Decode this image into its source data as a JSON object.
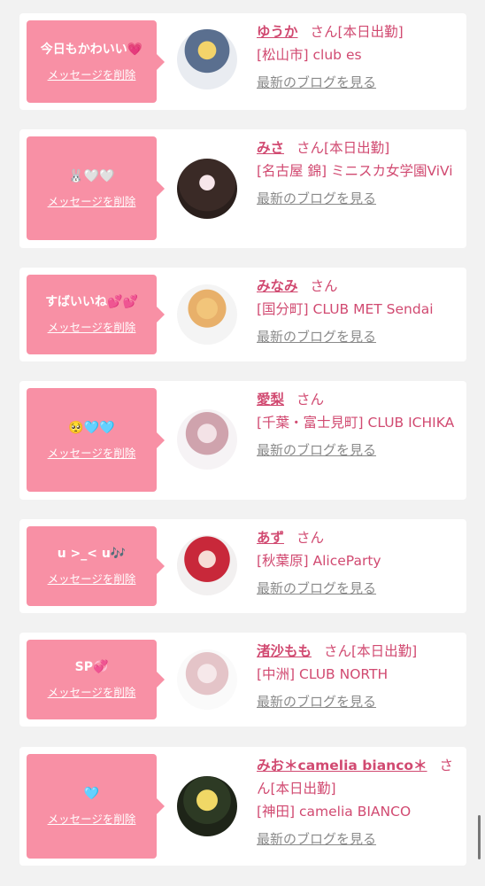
{
  "colors": {
    "bubble": "#f890a5",
    "accent": "#d14a71",
    "muted": "#8a8a8a"
  },
  "delete_label": "メッセージを削除",
  "blog_label": "最新のブログを見る",
  "cards": [
    {
      "message": "今日もかわいい💗",
      "name": "ゆうか",
      "suffix": "さん[本日出勤]",
      "shop": "[松山市] club es"
    },
    {
      "message": "🐰🤍🤍",
      "name": "みさ",
      "suffix": "さん[本日出勤]",
      "shop": "[名古屋 錦] ミニスカ女学園ViVi"
    },
    {
      "message": "すばいいね💕💕",
      "name": "みなみ",
      "suffix": "さん",
      "shop": "[国分町] CLUB MET Sendai"
    },
    {
      "message": "🥺🩵🩵",
      "name": "愛梨",
      "suffix": "さん",
      "shop": "[千葉・富士見町] CLUB ICHIKA"
    },
    {
      "message": "u >_< u🎶",
      "name": "あず",
      "suffix": "さん",
      "shop": "[秋葉原] AliceParty"
    },
    {
      "message": "SP💞",
      "name": "渚沙もも",
      "suffix": "さん[本日出勤]",
      "shop": "[中洲] CLUB NORTH"
    },
    {
      "message": "🩵",
      "name": "みお＊camelia bianco＊",
      "suffix": "さん[本日出勤]",
      "shop": "[神田] camelia BIANCO"
    }
  ]
}
